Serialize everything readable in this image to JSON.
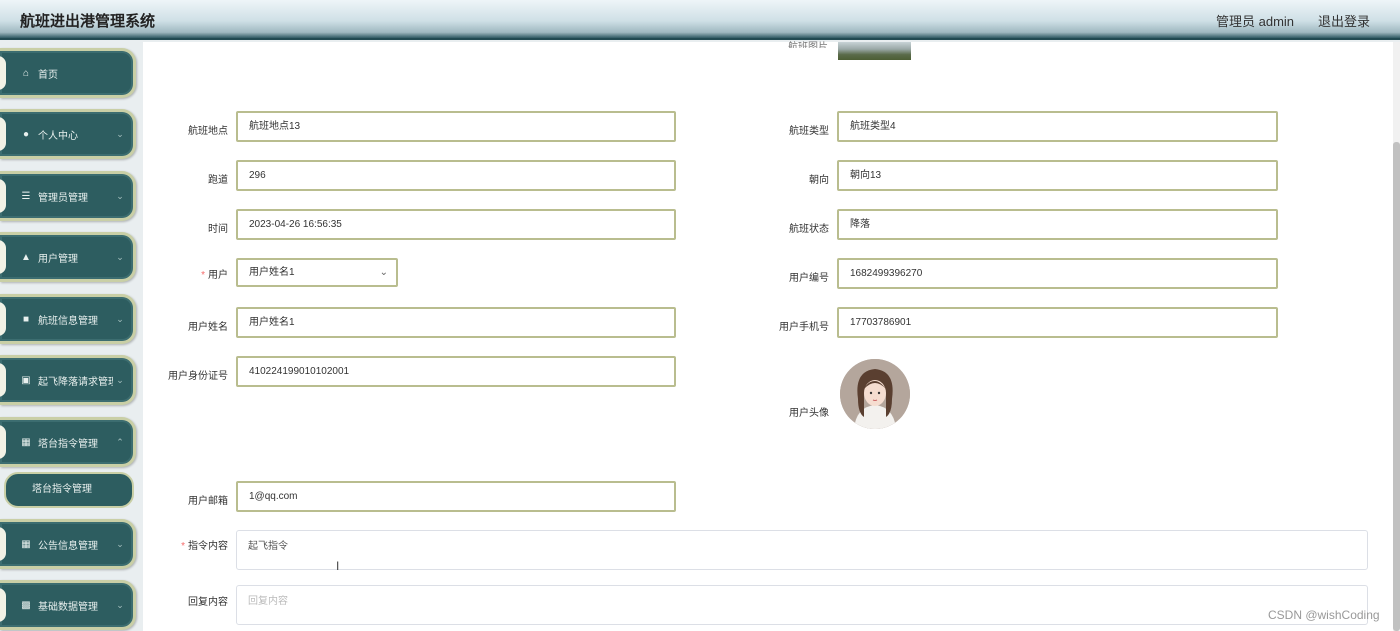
{
  "header": {
    "app_title": "航班进出港管理系统",
    "admin_label": "管理员 admin",
    "logout_label": "退出登录"
  },
  "sidebar": {
    "items": [
      {
        "label": "首页",
        "icon": "home-icon"
      },
      {
        "label": "个人中心",
        "icon": "user-icon"
      },
      {
        "label": "管理员管理",
        "icon": "list-icon"
      },
      {
        "label": "用户管理",
        "icon": "thumb-icon"
      },
      {
        "label": "航班信息管理",
        "icon": "book-icon"
      },
      {
        "label": "起飞降落请求管理",
        "icon": "briefcase-icon"
      },
      {
        "label": "塔台指令管理",
        "icon": "grid-icon"
      },
      {
        "label": "公告信息管理",
        "icon": "grid-icon"
      },
      {
        "label": "基础数据管理",
        "icon": "chart-icon"
      }
    ],
    "submenu_active": "塔台指令管理"
  },
  "form": {
    "top_image_label": "航班图片",
    "flight_location": {
      "label": "航班地点",
      "value": "航班地点13"
    },
    "flight_type": {
      "label": "航班类型",
      "value": "航班类型4"
    },
    "runway": {
      "label": "跑道",
      "value": "296"
    },
    "heading": {
      "label": "朝向",
      "value": "朝向13"
    },
    "time": {
      "label": "时间",
      "value": "2023-04-26 16:56:35"
    },
    "flight_status": {
      "label": "航班状态",
      "value": "降落"
    },
    "user": {
      "label": "用户",
      "value": "用户姓名1",
      "required": "*"
    },
    "user_no": {
      "label": "用户编号",
      "value": "1682499396270"
    },
    "user_name": {
      "label": "用户姓名",
      "value": "用户姓名1"
    },
    "user_phone": {
      "label": "用户手机号",
      "value": "17703786901"
    },
    "user_id": {
      "label": "用户身份证号",
      "value": "410224199010102001"
    },
    "user_avatar": {
      "label": "用户头像"
    },
    "user_email": {
      "label": "用户邮箱",
      "value": "1@qq.com"
    },
    "instruction": {
      "label": "指令内容",
      "value": "起飞指令",
      "required": "*"
    },
    "reply": {
      "label": "回复内容",
      "placeholder": "回复内容"
    }
  },
  "watermark": "CSDN @wishCoding",
  "colors": {
    "sidebar_bg": "#2d5d60",
    "border_accent": "#b9bd8f",
    "required": "#f56c6c"
  }
}
